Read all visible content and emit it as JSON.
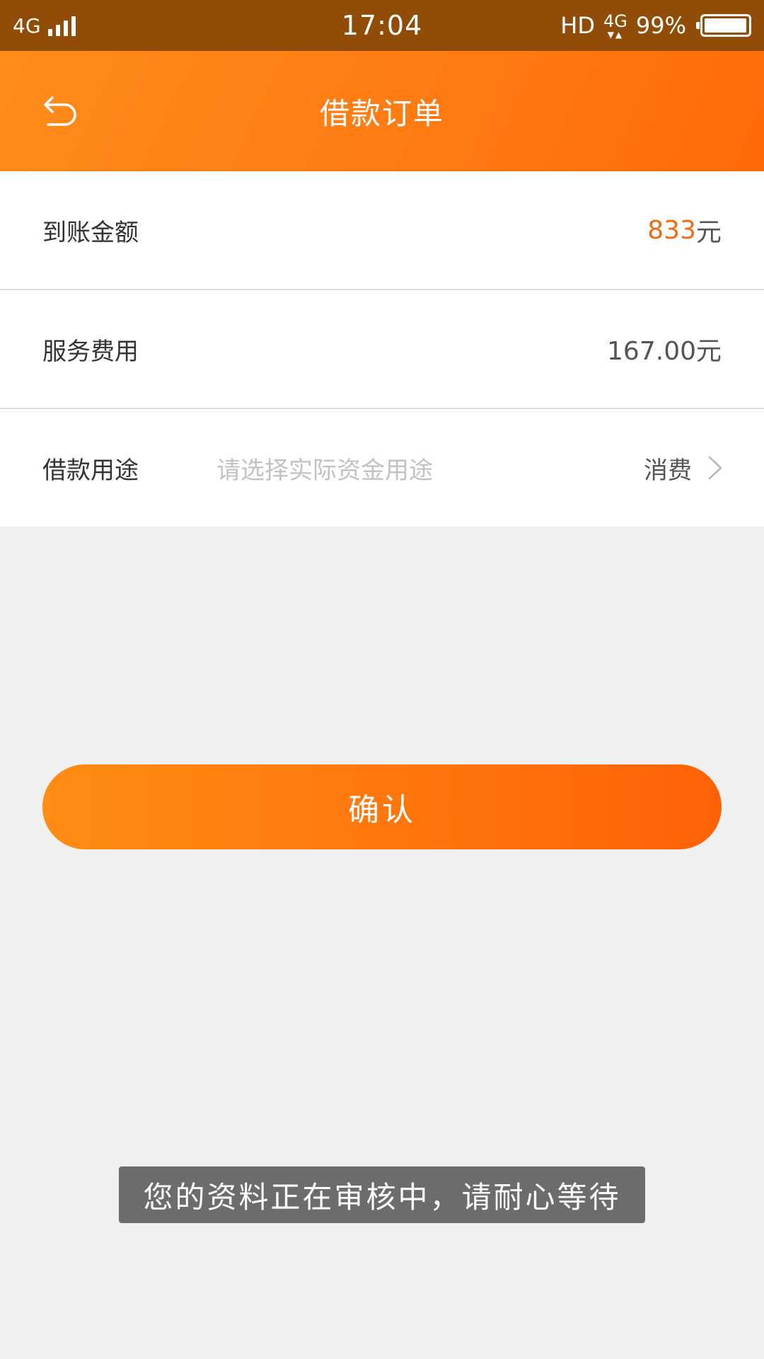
{
  "status_bar": {
    "network_left": "4G",
    "time": "17:04",
    "hd": "HD",
    "network_right": "4G",
    "battery": "99%",
    "battery_level": 0.99
  },
  "header": {
    "title": "借款订单",
    "back_icon": "back-arrow-icon"
  },
  "rows": {
    "amount": {
      "label": "到账金额",
      "value": "833",
      "unit": "元"
    },
    "fee": {
      "label": "服务费用",
      "value": "167.00元"
    },
    "purpose": {
      "label": "借款用途",
      "placeholder": "请选择实际资金用途",
      "value": "消费",
      "icon": "chevron-right-icon"
    }
  },
  "confirm_button": {
    "label": "确认"
  },
  "toast": {
    "message": "您的资料正在审核中，请耐心等待"
  },
  "colors": {
    "status_bar": "#914c07",
    "accent": "#ff7a12",
    "amount": "#f06a12",
    "background": "#f0f0f0"
  }
}
